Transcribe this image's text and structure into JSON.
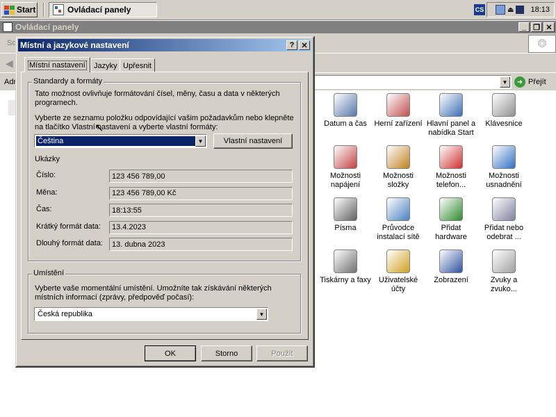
{
  "taskbar": {
    "start_label": "Start",
    "task_label": "Ovládací panely",
    "tray_lang": "CS",
    "clock": "18:13"
  },
  "explorer": {
    "title": "Ovládací panely",
    "menu_partial": "So",
    "address_partial": "Adr",
    "go_label": "Přejít",
    "items": [
      {
        "label": "Datum a čas",
        "icon": "clock-icon"
      },
      {
        "label": "Herní zařízení",
        "icon": "joystick-icon"
      },
      {
        "label": "Hlavní panel a nabídka Start",
        "icon": "taskbar-icon"
      },
      {
        "label": "Klávesnice",
        "icon": "keyboard-icon"
      },
      {
        "label": "Možnosti napájení",
        "icon": "power-icon"
      },
      {
        "label": "Možnosti složky",
        "icon": "folder-options-icon"
      },
      {
        "label": "Možnosti telefon...",
        "icon": "phone-icon"
      },
      {
        "label": "Možnosti usnadnění",
        "icon": "accessibility-icon"
      },
      {
        "label": "Písma",
        "icon": "fonts-icon"
      },
      {
        "label": "Průvodce instalací sítě",
        "icon": "network-wizard-icon"
      },
      {
        "label": "Přidat hardware",
        "icon": "hardware-icon"
      },
      {
        "label": "Přidat nebo odebrat ...",
        "icon": "add-remove-icon"
      },
      {
        "label": "Tiskárny a faxy",
        "icon": "printer-icon"
      },
      {
        "label": "Uživatelské účty",
        "icon": "users-icon"
      },
      {
        "label": "Zobrazení",
        "icon": "display-icon"
      },
      {
        "label": "Zvuky a zvuko...",
        "icon": "sound-icon"
      }
    ]
  },
  "dialog": {
    "title": "Místní a jazykové nastavení",
    "help_btn": "?",
    "close_btn": "✕",
    "tabs": [
      "Místní nastavení",
      "Jazyky",
      "Upřesnit"
    ],
    "standards": {
      "legend": "Standardy a formáty",
      "desc1": "Tato možnost ovlivňuje formátování čísel, měny, času a data v některých programech.",
      "desc2": "Vyberte ze seznamu položku odpovídající vašim požadavkům nebo klepněte na tlačítko Vlastní nastavení a vyberte vlastní formáty:",
      "selected": "Čeština",
      "custom_btn": "Vlastní nastavení"
    },
    "samples": {
      "heading": "Ukázky",
      "rows": [
        {
          "label": "Číslo:",
          "value": "123 456 789,00"
        },
        {
          "label": "Měna:",
          "value": "123 456 789,00 Kč"
        },
        {
          "label": "Čas:",
          "value": "18:13:55"
        },
        {
          "label": "Krátký formát data:",
          "value": "13.4.2023"
        },
        {
          "label": "Dlouhý formát data:",
          "value": "13. dubna 2023"
        }
      ]
    },
    "location": {
      "legend": "Umístění",
      "desc": "Vyberte vaše momentální umístění. Umožníte tak získávání některých místních informací (zprávy, předpověď počasí):",
      "selected": "Česká republika"
    },
    "buttons": {
      "ok": "OK",
      "cancel": "Storno",
      "apply": "Použít"
    }
  }
}
